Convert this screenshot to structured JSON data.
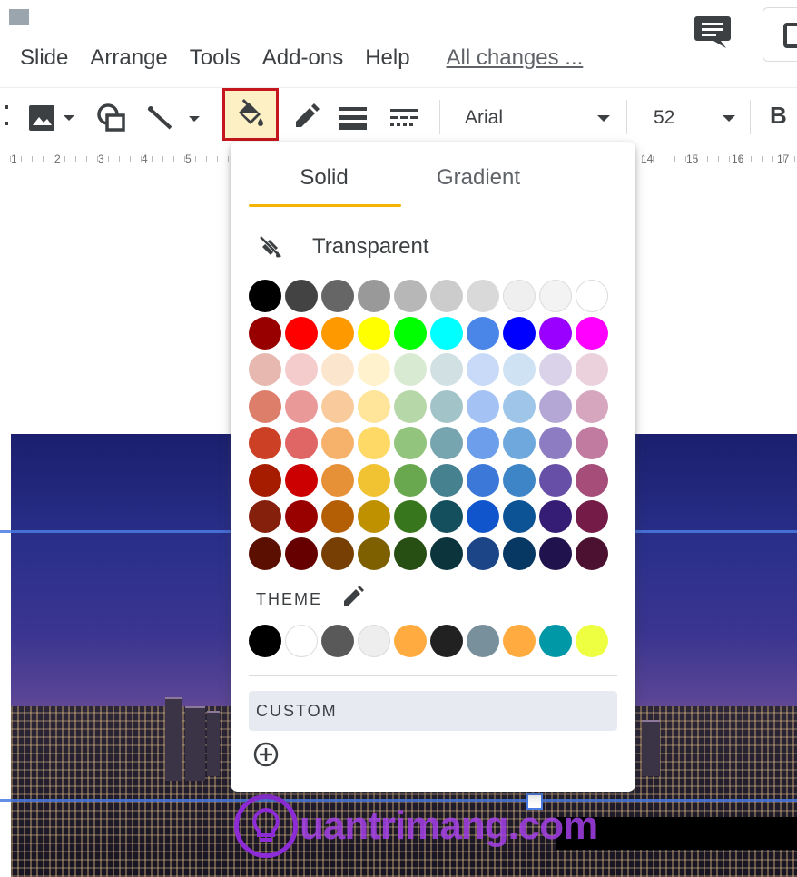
{
  "menu": {
    "items": [
      "Slide",
      "Arrange",
      "Tools",
      "Add-ons",
      "Help"
    ],
    "save_status": "All changes ..."
  },
  "toolbar": {
    "font": "Arial",
    "font_size": "52",
    "bold_label": "B",
    "icons": [
      "image-icon",
      "shapes-icon",
      "line-icon",
      "fill-color-icon",
      "border-color-icon",
      "border-weight-icon",
      "border-dash-icon"
    ]
  },
  "ruler": {
    "left_ticks": [
      "1",
      "2",
      "3",
      "4",
      "5"
    ],
    "right_ticks": [
      "14",
      "15",
      "16",
      "17"
    ]
  },
  "fill_popup": {
    "tabs": [
      "Solid",
      "Gradient"
    ],
    "active_tab": "Solid",
    "transparent_label": "Transparent",
    "palette": [
      [
        "#000000",
        "#434343",
        "#666666",
        "#999999",
        "#b7b7b7",
        "#cccccc",
        "#d9d9d9",
        "#efefef",
        "#f3f3f3",
        "#ffffff"
      ],
      [
        "#980000",
        "#ff0000",
        "#ff9900",
        "#ffff00",
        "#00ff00",
        "#00ffff",
        "#4a86e8",
        "#0000ff",
        "#9900ff",
        "#ff00ff"
      ],
      [
        "#e6b8af",
        "#f4cccc",
        "#fce5cd",
        "#fff2cc",
        "#d9ead3",
        "#d0e0e3",
        "#c9daf8",
        "#cfe2f3",
        "#d9d2e9",
        "#ead1dc"
      ],
      [
        "#dd7e6b",
        "#ea9999",
        "#f9cb9c",
        "#ffe599",
        "#b6d7a8",
        "#a2c4c9",
        "#a4c2f4",
        "#9fc5e8",
        "#b4a7d6",
        "#d5a6bd"
      ],
      [
        "#cc4125",
        "#e06666",
        "#f6b26b",
        "#ffd966",
        "#93c47d",
        "#76a5af",
        "#6d9eeb",
        "#6fa8dc",
        "#8e7cc3",
        "#c27ba0"
      ],
      [
        "#a61c00",
        "#cc0000",
        "#e69138",
        "#f1c232",
        "#6aa84f",
        "#45818e",
        "#3c78d8",
        "#3d85c6",
        "#674ea7",
        "#a64d79"
      ],
      [
        "#85200c",
        "#990000",
        "#b45f06",
        "#bf9000",
        "#38761d",
        "#134f5c",
        "#1155cc",
        "#0b5394",
        "#351c75",
        "#741b47"
      ],
      [
        "#5b0f00",
        "#660000",
        "#783f04",
        "#7f6000",
        "#274e13",
        "#0c343d",
        "#1c4587",
        "#073763",
        "#20124d",
        "#4c1130"
      ]
    ],
    "theme_label": "THEME",
    "theme_colors": [
      "#000000",
      "#ffffff",
      "#595959",
      "#eeeeee",
      "#ffab40",
      "#212121",
      "#78909c",
      "#ffab40",
      "#0097a7",
      "#eeff41"
    ],
    "custom_label": "CUSTOM"
  },
  "watermark": {
    "text": "uantrimang.com"
  }
}
